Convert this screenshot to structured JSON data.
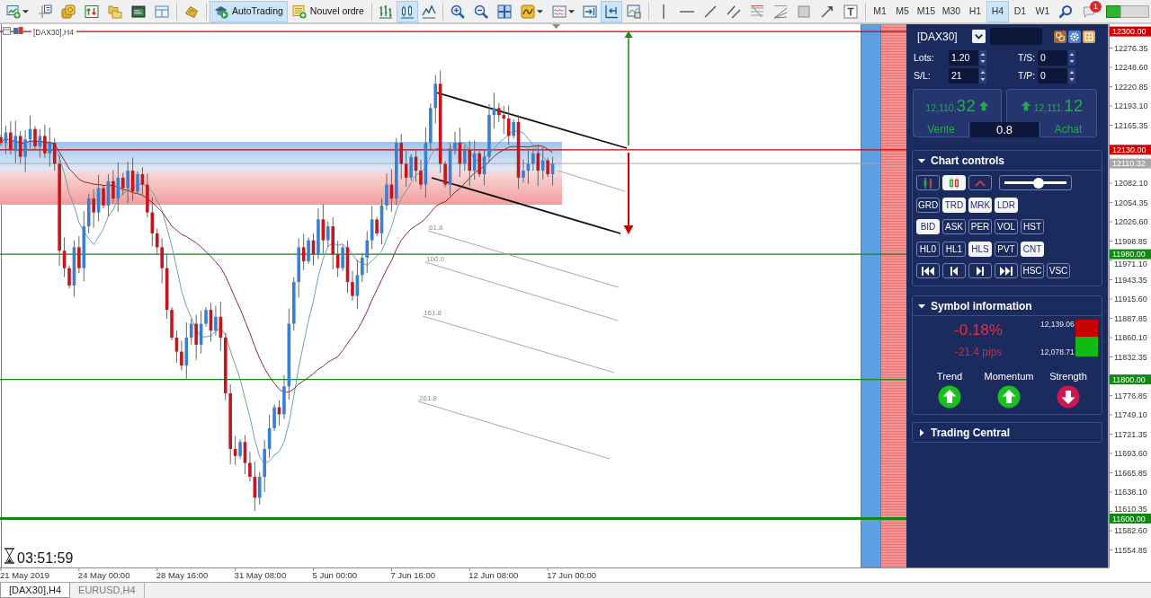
{
  "toolbar": {
    "autotrading": {
      "label": "AutoTrading",
      "on": true
    },
    "new_order": {
      "label": "Nouvel ordre"
    },
    "chart_types": [
      {
        "selected": false
      },
      {
        "selected": true
      },
      {
        "selected": false
      }
    ],
    "scroll_toggles": [
      {
        "on": false
      },
      {
        "on": true
      }
    ],
    "timeframes": [
      {
        "label": "M1",
        "selected": false
      },
      {
        "label": "M5",
        "selected": false
      },
      {
        "label": "M15",
        "selected": false
      },
      {
        "label": "M30",
        "selected": false
      },
      {
        "label": "H1",
        "selected": false
      },
      {
        "label": "H4",
        "selected": true
      },
      {
        "label": "D1",
        "selected": false
      },
      {
        "label": "W1",
        "selected": false
      }
    ],
    "notification_count": "1"
  },
  "chart": {
    "title": "[DAX30],H4",
    "countdown": "03:51:59",
    "fibo_levels": [
      "61.8",
      "100.0",
      "161.8",
      "261.8"
    ],
    "price_axis": {
      "labels": [
        "12276.35",
        "12248.60",
        "12220.85",
        "12193.10",
        "12165.35",
        "12082.10",
        "12054.35",
        "12026.60",
        "11998.85",
        "11971.10",
        "11943.35",
        "11915.60",
        "11887.85",
        "11860.10",
        "11832.35",
        "11776.85",
        "11749.10",
        "11721.35",
        "11693.60",
        "11665.85",
        "11638.10",
        "11610.35",
        "11582.60",
        "11554.85"
      ]
    },
    "price_tags": [
      {
        "kind": "level",
        "label": "12300.00",
        "color": "#cc0000"
      },
      {
        "kind": "level",
        "label": "12130.00",
        "color": "#cc0000"
      },
      {
        "kind": "price",
        "label": "12110.32",
        "color": "#a8a8a8"
      },
      {
        "kind": "level",
        "label": "11980.00",
        "color": "#118811"
      },
      {
        "kind": "level",
        "label": "11800.00",
        "color": "#118811"
      },
      {
        "kind": "strong_level",
        "label": "11600.00",
        "color": "#118811"
      }
    ],
    "time_axis": {
      "labels": [
        "21 May 2019",
        "24 May 00:00",
        "28 May 16:00",
        "31 May 08:00",
        "5 Jun 00:00",
        "7 Jun 16:00",
        "12 Jun 08:00",
        "17 Jun 00:00"
      ]
    }
  },
  "trade_panel": {
    "symbol": "[DAX30]",
    "fields": [
      {
        "label": "Lots:",
        "value": "1.20"
      },
      {
        "label": "T/S:",
        "value": "0"
      },
      {
        "label": "S/L:",
        "value": "21"
      },
      {
        "label": "T/P:",
        "value": "0"
      }
    ],
    "sell": {
      "price_head": "12,110.",
      "price_tail": "32",
      "label": "Vente"
    },
    "buy": {
      "price_head": "12,111.",
      "price_tail": "12",
      "label": "Achat"
    },
    "spread": "0.8"
  },
  "chart_controls": {
    "title": "Chart controls",
    "expanded": true,
    "view_buttons": [
      {
        "selected": false
      },
      {
        "selected": true
      },
      {
        "selected": false
      }
    ],
    "zoom_slider": {
      "level": 0.56
    },
    "rows": [
      [
        {
          "label": "GRD",
          "selected": false
        },
        {
          "label": "TRD",
          "selected": true
        },
        {
          "label": "MRK",
          "selected": true
        },
        {
          "label": "LDR",
          "selected": true
        }
      ],
      [
        {
          "label": "BID",
          "selected": true
        },
        {
          "label": "ASK",
          "selected": false
        },
        {
          "label": "PER",
          "selected": false
        },
        {
          "label": "VOL",
          "selected": false
        },
        {
          "label": "HST",
          "selected": false
        }
      ],
      [
        {
          "label": "HL0",
          "selected": false
        },
        {
          "label": "HL1",
          "selected": false
        },
        {
          "label": "HLS",
          "selected": true
        },
        {
          "label": "PVT",
          "selected": false
        },
        {
          "label": "CNT",
          "selected": true
        }
      ]
    ],
    "scroll_buttons": [
      {
        "label": "HSC",
        "selected": false
      },
      {
        "label": "VSC",
        "selected": false
      }
    ]
  },
  "symbol_info": {
    "title": "Symbol information",
    "expanded": true,
    "change_percent": "-0.18%",
    "change_pips": "-21.4 pips",
    "high": "12,139.06",
    "low": "12,078.71",
    "signals": [
      {
        "label": "Trend",
        "rising": true
      },
      {
        "label": "Momentum",
        "rising": true
      },
      {
        "label": "Strength",
        "rising": false
      }
    ]
  },
  "trading_central": {
    "title": "Trading Central",
    "expanded": false
  },
  "tabs": [
    {
      "label": "[DAX30],H4",
      "selected": true
    },
    {
      "label": "EURUSD,H4",
      "selected": false
    }
  ]
}
